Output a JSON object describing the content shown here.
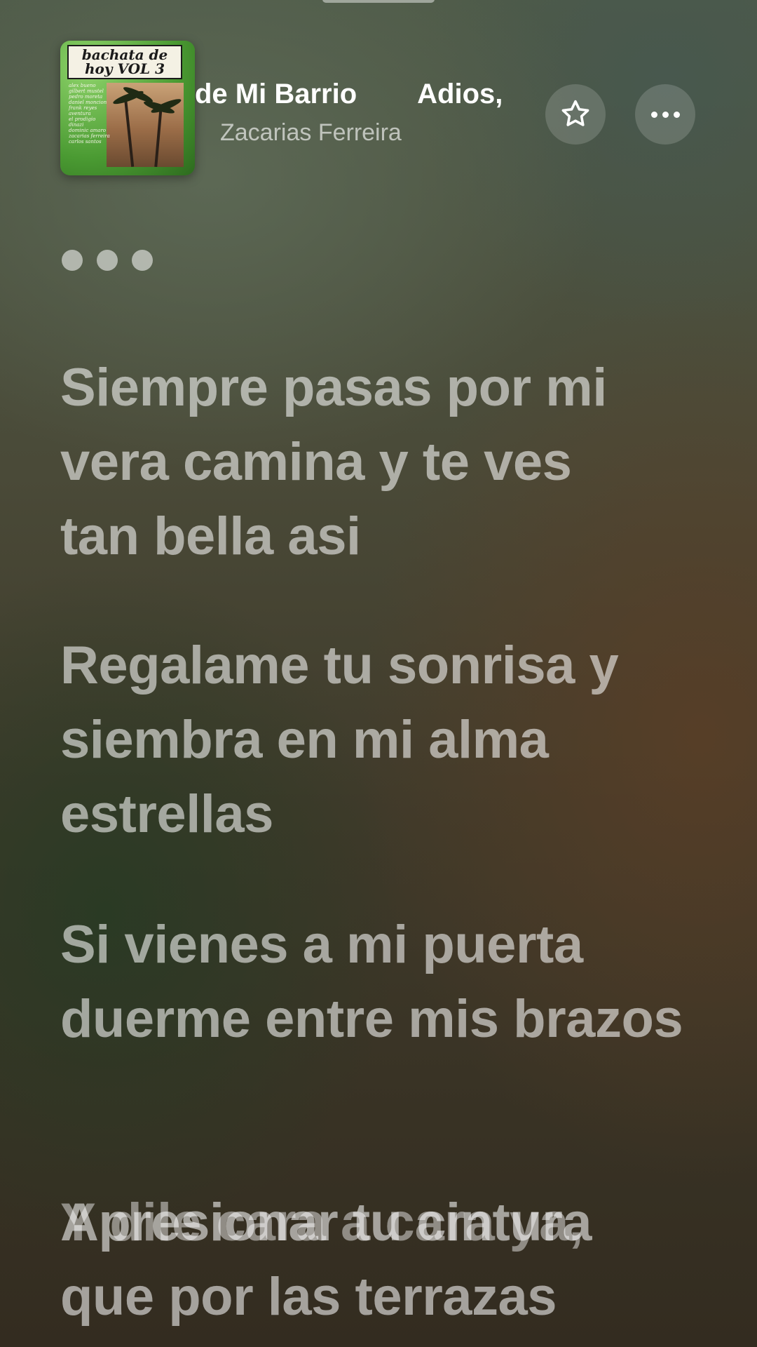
{
  "now_playing": {
    "title_visible_left": "de Mi Barrio",
    "next_title_partial": "Adios, ",
    "artist": "Zacarias Ferreira",
    "album_art_title": "bachata de hoy VOL 3",
    "album_art_list": [
      "alex bueno",
      "gilbert mustel",
      "pedro moreta",
      "daniel moncion",
      "frank reyes",
      "aventura",
      "el prodigio",
      "dinazi",
      "dominic amaro",
      "zacarias ferreira",
      "carlos santos"
    ]
  },
  "controls": {
    "favorite_icon": "star-icon",
    "more_icon": "ellipsis-icon"
  },
  "lyrics": {
    "interlude_icon": "interlude-dots",
    "lines": [
      "Siempre pasas por mi vera camina y te ves tan bella asi",
      "Regalame tu sonrisa y siembra en mi alma estrellas",
      "Si vienes a mi puerta duerme entre mis brazos",
      "Apresionar tu cintura que por las terrazas"
    ],
    "overlapping_line": "Y dile cara a cara ya,"
  },
  "colors": {
    "text_active": "#ffffff",
    "text_dim": "rgba(255,255,255,0.56)"
  }
}
